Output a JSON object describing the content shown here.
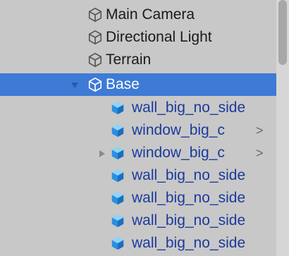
{
  "hierarchy": {
    "items": [
      {
        "label": "Main Camera",
        "type": "gameobject-icon"
      },
      {
        "label": "Directional Light",
        "type": "gameobject-icon"
      },
      {
        "label": "Terrain",
        "type": "gameobject-icon"
      },
      {
        "label": "Base",
        "type": "gameobject-icon",
        "selected": true,
        "expanded": true
      },
      {
        "label": "wall_big_no_side",
        "type": "prefab-icon"
      },
      {
        "label": "window_big_c",
        "type": "prefab-icon",
        "chevron": ">"
      },
      {
        "label": "window_big_c",
        "type": "prefab-icon",
        "chevron": ">",
        "collapsed_foldout": true
      },
      {
        "label": "wall_big_no_side",
        "type": "prefab-icon"
      },
      {
        "label": "wall_big_no_side",
        "type": "prefab-icon"
      },
      {
        "label": "wall_big_no_side",
        "type": "prefab-icon"
      },
      {
        "label": "wall_big_no_side",
        "type": "prefab-icon"
      }
    ]
  },
  "colors": {
    "selection": "#3d7bd6",
    "prefab_text": "#1b3a9c",
    "background": "#c8c8c8"
  }
}
